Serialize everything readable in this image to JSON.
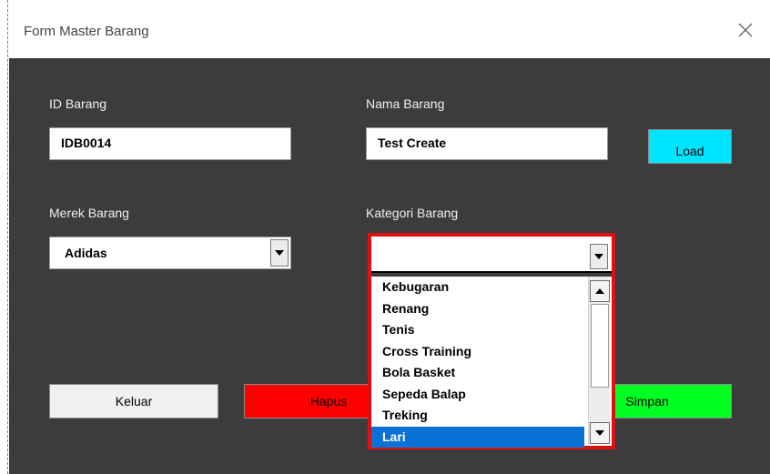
{
  "window": {
    "title": "Form Master Barang",
    "close_icon": "close-icon"
  },
  "labels": {
    "id_barang": "ID Barang",
    "nama_barang": "Nama Barang",
    "merek_barang": "Merek Barang",
    "kategori_barang": "Kategori Barang"
  },
  "fields": {
    "id_barang": "IDB0014",
    "nama_barang": "Test Create",
    "merek_barang": "Adidas",
    "kategori_barang": ""
  },
  "buttons": {
    "load": "Load",
    "keluar": "Keluar",
    "hapus": "Hapus",
    "simpan": "Simpan"
  },
  "dropdown": {
    "items": [
      "Kebugaran",
      "Renang",
      "Tenis",
      "Cross Training",
      "Bola Basket",
      "Sepeda Balap",
      "Treking",
      "Lari"
    ],
    "selected": "Lari"
  },
  "colors": {
    "client_bg": "#3c3c3c",
    "load_button": "#00e5ff",
    "hapus_button": "#ff0000",
    "simpan_button": "#00ff22",
    "highlight_border": "#e01010",
    "selection": "#0a72d6"
  }
}
